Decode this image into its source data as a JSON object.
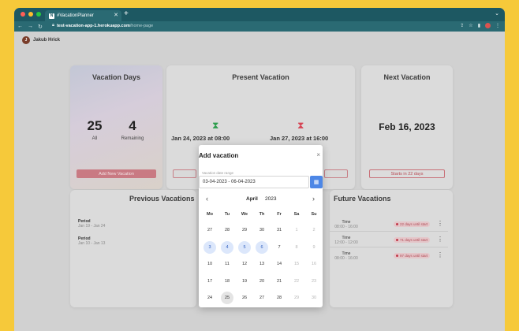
{
  "browser": {
    "tab_title": "#VacationPlanner",
    "url_host": "test-vacation-app-1.herokuapp.com",
    "url_path": "/home-page"
  },
  "user": {
    "initial": "J",
    "name": "Jakub Hrick"
  },
  "vacation_days": {
    "title": "Vacation Days",
    "all_value": "25",
    "all_label": "All",
    "remaining_value": "4",
    "remaining_label": "Remaining",
    "add_button": "Add New Vacation"
  },
  "present_vacation": {
    "title": "Present Vacation",
    "start_text": "Jan 24, 2023 at 08:00",
    "end_text": "Jan 27, 2023 at 16:00"
  },
  "next_vacation": {
    "title": "Next Vacation",
    "date": "Feb 16, 2023",
    "starts_in": "Starts in 22 days"
  },
  "previous_vacations": {
    "title": "Previous Vacations",
    "rows": [
      {
        "label": "Period",
        "dates": "Jan 19 - Jan 24"
      },
      {
        "label": "Period",
        "dates": "Jan 10 - Jan 13"
      }
    ]
  },
  "future_vacations": {
    "title": "Future Vacations",
    "rows": [
      {
        "label": "Time",
        "time": "08:00 - 16:00",
        "badge": "22 days until start"
      },
      {
        "label": "Time",
        "time": "12:00 - 12:00",
        "badge": "71 days until start"
      },
      {
        "label": "Time",
        "time": "08:00 - 16:00",
        "badge": "97 days until start"
      }
    ]
  },
  "modal": {
    "title": "Add vacation",
    "close": "×",
    "field_label": "Vacation date range",
    "field_value": "03-04-2023 - 06-04-2023",
    "calendar": {
      "month": "April",
      "year": "2023",
      "weekdays": [
        "Mo",
        "Tu",
        "We",
        "Th",
        "Fr",
        "Sa",
        "Su"
      ],
      "weeks": [
        [
          "27",
          "28",
          "29",
          "30",
          "31",
          "1",
          "2"
        ],
        [
          "3",
          "4",
          "5",
          "6",
          "7",
          "8",
          "9"
        ],
        [
          "10",
          "11",
          "12",
          "13",
          "14",
          "15",
          "16"
        ],
        [
          "17",
          "18",
          "19",
          "20",
          "21",
          "22",
          "23"
        ],
        [
          "24",
          "25",
          "26",
          "27",
          "28",
          "29",
          "30"
        ]
      ],
      "selected": [
        "3",
        "4",
        "5",
        "6"
      ],
      "today": "25"
    }
  },
  "colors": {
    "accent_blue": "#4d87e6",
    "danger": "#c0394a",
    "hourglass_start": "#2e9e4e",
    "hourglass_end": "#d64555"
  }
}
